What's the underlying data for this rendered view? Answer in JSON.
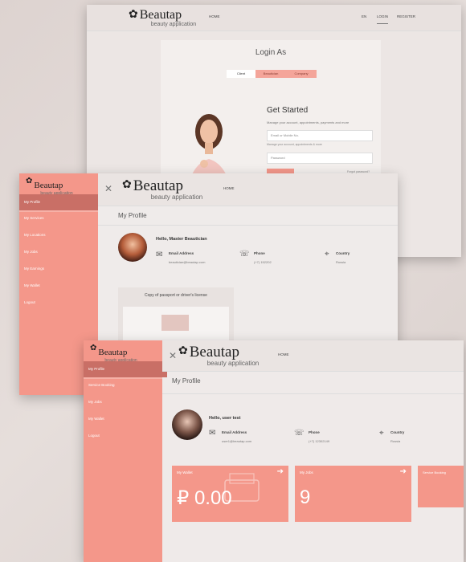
{
  "brand": {
    "name": "Beautap",
    "tagline": "beauty application",
    "flower": "✿"
  },
  "screen1": {
    "nav": {
      "home": "HOME",
      "lang": "EN",
      "login": "LOGIN",
      "register": "REGISTER"
    },
    "login_as": "Login As",
    "roles": [
      "Client",
      "Beautician",
      "Company"
    ],
    "get_started": "Get Started",
    "intro": "Manage your account, appointments, payments and more",
    "email_placeholder": "Email or Mobile No.",
    "email_help": "Manage your account, appointments & more",
    "password_placeholder": "Password",
    "forgot": "Forgot password?"
  },
  "screen2": {
    "nav": {
      "home": "HOME"
    },
    "sidebar": [
      "My Profile",
      "My Services",
      "My Locations",
      "My Jobs",
      "My Earnings",
      "My Wallet",
      "Logout"
    ],
    "page_title": "My Profile",
    "hello": "Hello, Master Beautician",
    "email_label": "Email Address",
    "email_value": "beautician@beautap.com",
    "phone_label": "Phone",
    "phone_value": "(+7) 152202",
    "country_label": "Country",
    "country_value": "Russia",
    "doc_title": "Copy of passport or driver's license"
  },
  "screen3": {
    "nav": {
      "home": "HOME"
    },
    "sidebar": [
      "My Profile",
      "Service Booking",
      "My Jobs",
      "My Wallet",
      "Logout"
    ],
    "page_title": "My Profile",
    "hello": "Hello, user test",
    "email_label": "Email Address",
    "email_value": "user1@beautap.com",
    "phone_label": "Phone",
    "phone_value": "(+7) 12302149",
    "country_label": "Country",
    "country_value": "Russia",
    "tiles": [
      {
        "title": "My Wallet",
        "value": "₽ 0.00"
      },
      {
        "title": "My Jobs",
        "value": "9"
      },
      {
        "title": "Service Booking",
        "value": ""
      }
    ]
  },
  "colors": {
    "accent": "#f4978a",
    "accent_dark": "#c96f66",
    "bg": "#ece6e4"
  }
}
